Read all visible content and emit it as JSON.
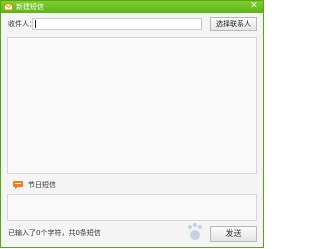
{
  "window": {
    "title": "新建短信",
    "close_symbol": "✕"
  },
  "recipient": {
    "label": "收件人：",
    "value": ""
  },
  "buttons": {
    "select_contact": "选择联系人",
    "send": "发送"
  },
  "holiday_sms": {
    "label": "节日短信"
  },
  "status": {
    "text": "已输入了0个字符，共0条短信"
  },
  "icons": {
    "app": "envelope-icon",
    "holiday": "message-bubble-icon",
    "close": "close-icon"
  },
  "colors": {
    "titlebar": "#6abf22",
    "holiday_icon": "#f07d1a"
  }
}
